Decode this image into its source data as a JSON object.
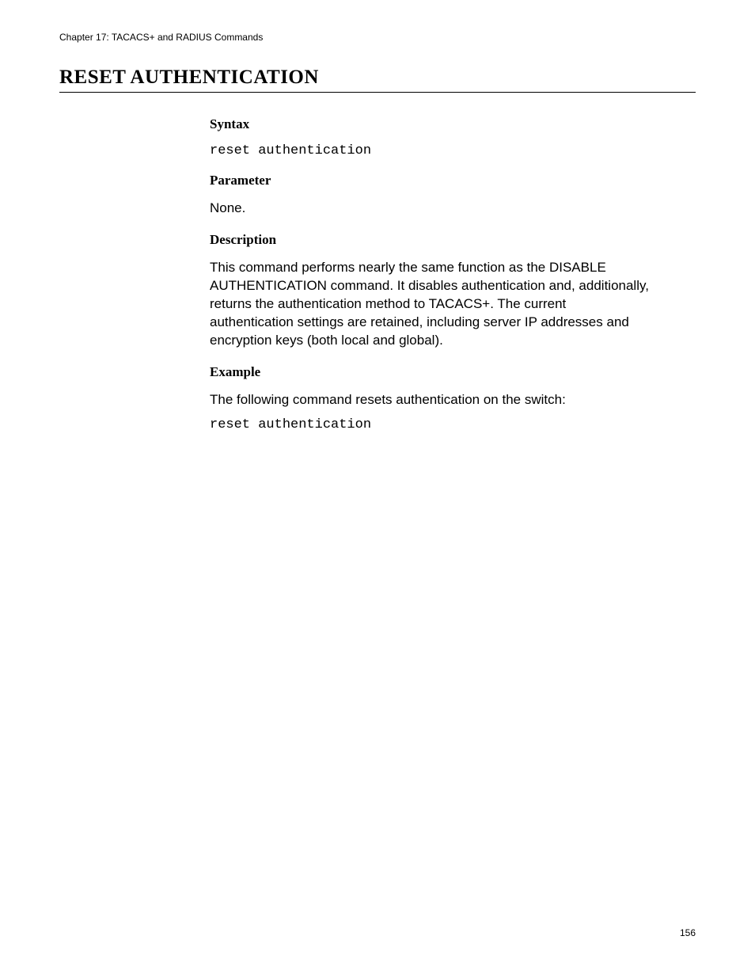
{
  "header": {
    "chapter": "Chapter 17: TACACS+ and RADIUS Commands"
  },
  "title": "RESET AUTHENTICATION",
  "sections": {
    "syntax": {
      "heading": "Syntax",
      "code": "reset authentication"
    },
    "parameter": {
      "heading": "Parameter",
      "text": "None."
    },
    "description": {
      "heading": "Description",
      "text": "This command performs nearly the same function as the DISABLE AUTHENTICATION command. It disables authentication and, additionally, returns the authentication method to TACACS+. The current authentication settings are retained, including server IP addresses and encryption keys (both local and global)."
    },
    "example": {
      "heading": "Example",
      "text": "The following command resets authentication on the switch:",
      "code": "reset authentication"
    }
  },
  "pageNumber": "156"
}
